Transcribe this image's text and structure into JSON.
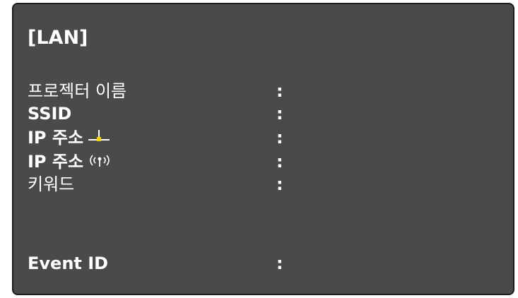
{
  "panel": {
    "title": "[LAN]",
    "rows": [
      {
        "label": "프로젝터 이름",
        "separator": ":"
      },
      {
        "label": "SSID",
        "separator": ":"
      },
      {
        "label": "IP 주소",
        "icon": "wired-lan-icon",
        "separator": ":"
      },
      {
        "label": "IP 주소",
        "icon": "wireless-lan-icon",
        "separator": ":"
      },
      {
        "label": "키워드",
        "separator": ":"
      },
      {
        "label": "Event ID",
        "separator": ":"
      }
    ]
  },
  "colors": {
    "panel_bg": "#4a4a4a",
    "text": "#ffffff",
    "wired_icon_accent": "#f5d300"
  }
}
